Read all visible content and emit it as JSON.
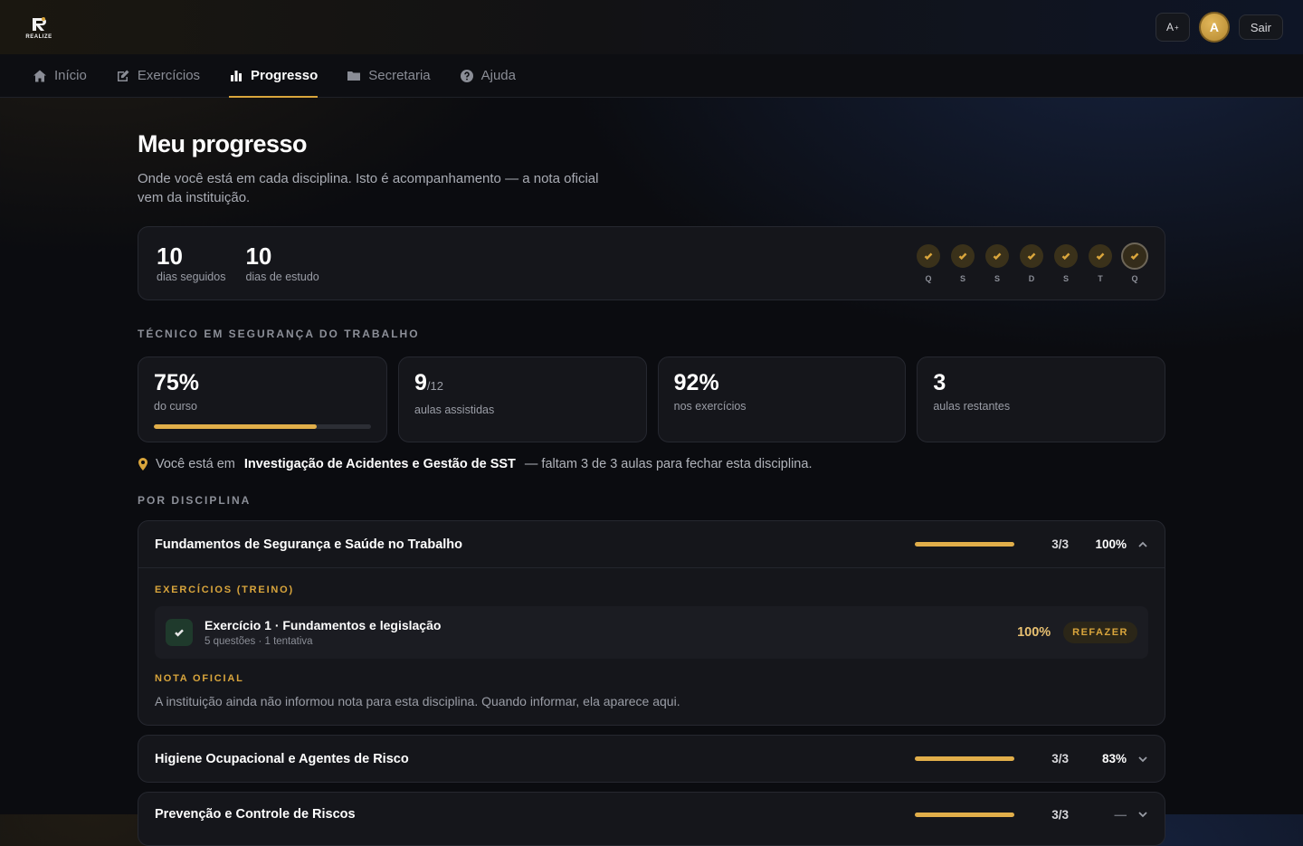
{
  "brand": {
    "logo_text": "REALIZE"
  },
  "header": {
    "font_button": "A",
    "font_button_sup": "+",
    "avatar_initial": "A",
    "exit_label": "Sair"
  },
  "nav": {
    "items": [
      {
        "label": "Início",
        "icon": "home-icon"
      },
      {
        "label": "Exercícios",
        "icon": "edit-icon"
      },
      {
        "label": "Progresso",
        "icon": "bar-chart-icon",
        "active": true
      },
      {
        "label": "Secretaria",
        "icon": "folder-icon"
      },
      {
        "label": "Ajuda",
        "icon": "help-icon"
      }
    ]
  },
  "page": {
    "title": "Meu progresso",
    "subtitle": "Onde você está em cada disciplina. Isto é acompanhamento — a nota oficial vem da instituição."
  },
  "streak": {
    "days_streak": "10",
    "days_streak_label": "dias seguidos",
    "study_days": "10",
    "study_days_label": "dias de estudo",
    "week": [
      "Q",
      "S",
      "S",
      "D",
      "S",
      "T",
      "Q"
    ]
  },
  "course": {
    "name": "TÉCNICO EM SEGURANÇA DO TRABALHO",
    "progress_value": "75%",
    "progress_label": "do curso",
    "progress_fraction": 0.75,
    "lessons_done": "9",
    "lessons_total": "/12",
    "lessons_label": "aulas assistidas",
    "exercises_value": "92%",
    "exercises_label": "nos exercícios",
    "remaining_value": "3",
    "remaining_label": "aulas restantes"
  },
  "where": {
    "prefix": "Você está em",
    "discipline": "Investigação de Acidentes e Gestão de SST",
    "suffix": "— faltam 3 de 3 aulas para fechar esta disciplina."
  },
  "disciplines_heading": "POR DISCIPLINA",
  "disciplines": [
    {
      "title": "Fundamentos de Segurança e Saúde no Trabalho",
      "count": "3/3",
      "pct": "100%",
      "progress": 1.0,
      "exercises_heading": "EXERCÍCIOS (TREINO)",
      "exercise": {
        "title": "Exercício 1 · Fundamentos e legislação",
        "meta": "5 questões · 1 tentativa",
        "score": "100%",
        "action": "REFAZER"
      },
      "grade_heading": "NOTA OFICIAL",
      "grade_text": "A instituição ainda não informou nota para esta disciplina. Quando informar, ela aparece aqui."
    },
    {
      "title": "Higiene Ocupacional e Agentes de Risco",
      "count": "3/3",
      "pct": "83%",
      "progress": 1.0
    },
    {
      "title": "Prevenção e Controle de Riscos",
      "count": "3/3",
      "pct": "—",
      "progress": 1.0
    }
  ],
  "colors": {
    "accent": "#d9a53c",
    "bar": "#e1ae4a",
    "background": "#0b0c10",
    "card": "#15161b"
  }
}
